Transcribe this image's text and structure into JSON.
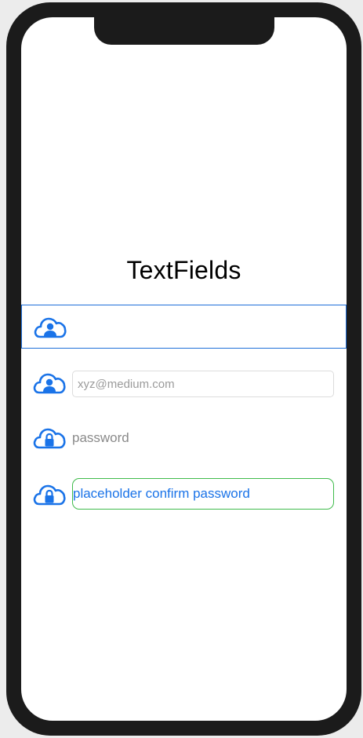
{
  "header": {
    "title": "TextFields"
  },
  "fields": [
    {
      "icon": "cloud-user-icon",
      "value": "",
      "placeholder": ""
    },
    {
      "icon": "cloud-user-icon",
      "value": "",
      "placeholder": "xyz@medium.com"
    },
    {
      "icon": "cloud-lock-icon",
      "value": "",
      "placeholder": "password"
    },
    {
      "icon": "cloud-lock-icon",
      "value": "placeholder confirm password",
      "placeholder": ""
    }
  ],
  "colors": {
    "accent": "#1a73e8",
    "confirm_border": "#3fbb4b",
    "active_border": "#1e6fd9"
  }
}
